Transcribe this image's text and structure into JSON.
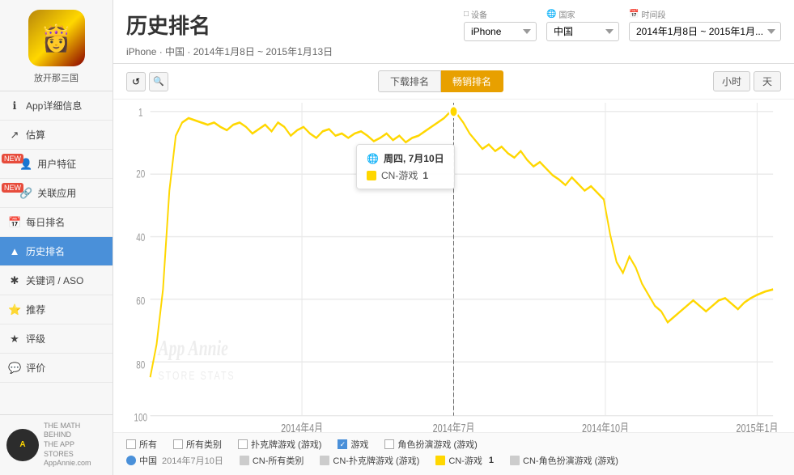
{
  "sidebar": {
    "app_name": "放开那三国",
    "items": [
      {
        "id": "app-detail",
        "label": "App详细信息",
        "icon": "ℹ",
        "active": false,
        "badge": null
      },
      {
        "id": "estimate",
        "label": "估算",
        "icon": "📈",
        "active": false,
        "badge": null
      },
      {
        "id": "user-feature",
        "label": "用户特征",
        "icon": "👤",
        "active": false,
        "badge": "NEW"
      },
      {
        "id": "related-apps",
        "label": "关联应用",
        "icon": "🔗",
        "active": false,
        "badge": "NEW"
      },
      {
        "id": "daily-rank",
        "label": "每日排名",
        "icon": "📅",
        "active": false,
        "badge": null
      },
      {
        "id": "history-rank",
        "label": "历史排名",
        "icon": "▲",
        "active": true,
        "badge": null
      },
      {
        "id": "keyword-aso",
        "label": "关键词 / ASO",
        "icon": "🔑",
        "active": false,
        "badge": null
      },
      {
        "id": "recommend",
        "label": "推荐",
        "icon": "⭐",
        "active": false,
        "badge": null
      },
      {
        "id": "rating",
        "label": "评级",
        "icon": "★",
        "active": false,
        "badge": null
      },
      {
        "id": "review",
        "label": "评价",
        "icon": "💬",
        "active": false,
        "badge": null
      }
    ],
    "footer": {
      "logo_text": "A",
      "line1": "THE MATH",
      "line2": "BEHIND",
      "line3": "THE APP STORES",
      "site": "AppAnnie.com"
    }
  },
  "header": {
    "title": "历史排名",
    "subtitle": "iPhone · 中国 · 2014年1月8日 ~ 2015年1月13日",
    "device_label": "□ 设备",
    "device_value": "iPhone",
    "country_label": "@ 国家",
    "country_value": "中国",
    "date_label": "📅 时间段",
    "date_value": "2014年1月8日 ~ 2015年1月..."
  },
  "chart": {
    "tab_download": "下载排名",
    "tab_bestseller": "畅销排名",
    "active_tab": "bestseller",
    "time_hour": "小时",
    "time_day": "天",
    "tool_reset": "↺",
    "tool_zoom": "🔍",
    "watermark1": "App Annie",
    "watermark2": "STORE STATS",
    "x_labels": [
      "2014年4月",
      "2014年7月",
      "2014年10月",
      "2015年1月"
    ],
    "y_labels": [
      "1",
      "20",
      "40",
      "60",
      "80",
      "100"
    ],
    "tooltip": {
      "day": "周四, 7月10日",
      "category": "CN-游戏",
      "value": "1",
      "globe_icon": "🌐"
    }
  },
  "legend": {
    "row1": [
      {
        "id": "all",
        "type": "checkbox",
        "checked": false,
        "label": "所有",
        "color": null
      },
      {
        "id": "all-category",
        "type": "checkbox",
        "checked": false,
        "label": "所有类别",
        "color": null
      },
      {
        "id": "poker",
        "type": "checkbox",
        "checked": false,
        "label": "扑克牌游戏 (游戏)",
        "color": null
      },
      {
        "id": "game",
        "type": "checkbox",
        "checked": true,
        "label": "游戏",
        "color": "#4a90d9"
      },
      {
        "id": "role-play",
        "type": "checkbox",
        "checked": false,
        "label": "角色扮演游戏 (游戏)",
        "color": null
      }
    ],
    "row2": [
      {
        "id": "china",
        "type": "dot",
        "color": "#4a90d9",
        "label": "中国",
        "date": "2014年7月10日"
      },
      {
        "id": "cn-all-cat",
        "type": "square",
        "color": "#ccc",
        "label": "CN-所有类别"
      },
      {
        "id": "cn-poker",
        "type": "square",
        "color": "#ccc",
        "label": "CN-扑克牌游戏 (游戏)"
      },
      {
        "id": "cn-game",
        "type": "square",
        "color": "#ffd700",
        "label": "CN-游戏",
        "value": "1"
      },
      {
        "id": "cn-role-play",
        "type": "square",
        "color": "#ccc",
        "label": "CN-角色扮演游戏 (游戏)"
      }
    ]
  }
}
